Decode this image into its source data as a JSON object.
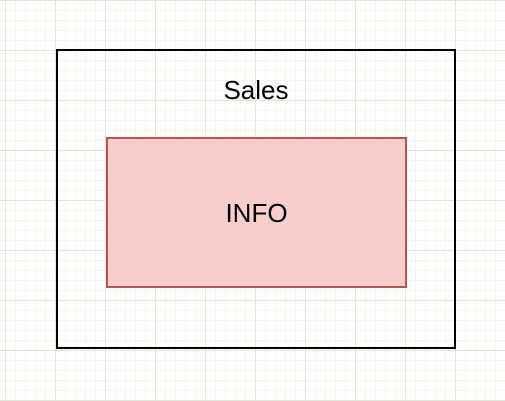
{
  "diagram": {
    "container": {
      "label": "Sales",
      "stroke_color": "#000000",
      "fill_color": "none"
    },
    "inner_box": {
      "label": "INFO",
      "stroke_color": "#b85450",
      "fill_color": "#f8cecc"
    },
    "grid": true
  }
}
